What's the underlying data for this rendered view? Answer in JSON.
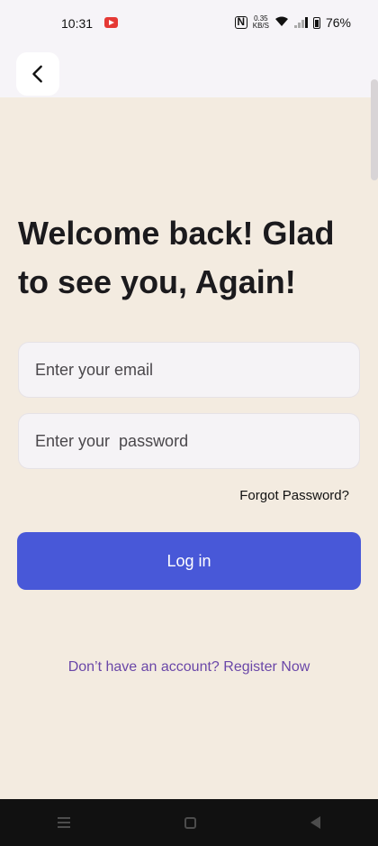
{
  "status_bar": {
    "time": "10:31",
    "net_speed_value": "0.35",
    "net_speed_unit": "KB/S",
    "battery": "76%",
    "icons": [
      "youtube-notification-icon",
      "nfc-icon",
      "wifi-icon",
      "signal-icon",
      "battery-icon"
    ]
  },
  "header": {
    "back_icon": "chevron-left-icon"
  },
  "main": {
    "title": "Welcome back! Glad to see you, Again!",
    "email_placeholder": "Enter your email",
    "password_placeholder": "Enter your  password",
    "forgot_password": "Forgot Password?",
    "login_label": "Log in",
    "register_prompt": "Don’t have an account? Register Now"
  },
  "colors": {
    "background": "#f3ebe0",
    "primary_button": "#4858d8",
    "link": "#6a47a8"
  }
}
